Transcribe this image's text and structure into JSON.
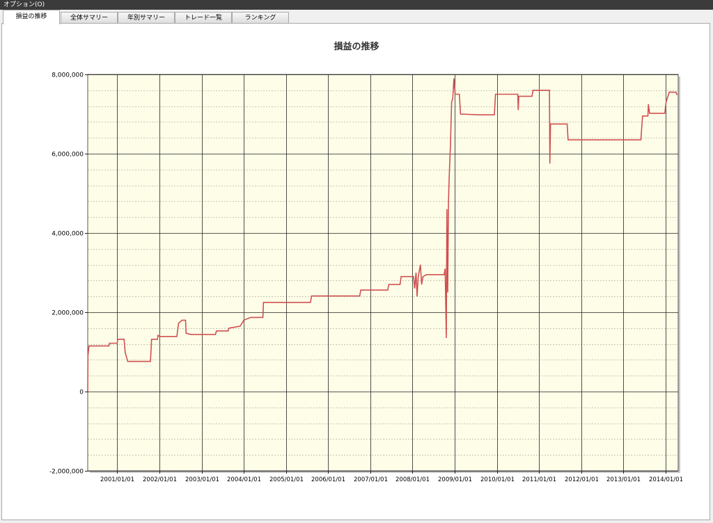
{
  "window": {
    "title": "オプション(O)"
  },
  "tabs": [
    {
      "label": "損益の推移",
      "active": true
    },
    {
      "label": "全体サマリー",
      "active": false
    },
    {
      "label": "年別サマリー",
      "active": false
    },
    {
      "label": "トレード一覧",
      "active": false
    },
    {
      "label": "ランキング",
      "active": false
    }
  ],
  "chart_data": {
    "type": "line",
    "title": "損益の推移",
    "xlabel": "",
    "ylabel": "",
    "ylim": [
      -2000000,
      8000000
    ],
    "y_ticks": [
      8000000,
      6000000,
      4000000,
      2000000,
      0,
      -2000000
    ],
    "y_tick_labels": [
      "8,000,000",
      "6,000,000",
      "4,000,000",
      "2,000,000",
      "0",
      "-2,000,000"
    ],
    "x_tick_labels": [
      "2001/01/01",
      "2002/01/01",
      "2003/01/01",
      "2004/01/01",
      "2005/01/01",
      "2006/01/01",
      "2007/01/01",
      "2008/01/01",
      "2009/01/01",
      "2010/01/01",
      "2011/01/01",
      "2012/01/01",
      "2013/01/01",
      "2014/01/01"
    ],
    "x_range": [
      "2000/04/20",
      "2014/04/20"
    ],
    "grid": true,
    "background_color": "#fefee8",
    "line_color": "#d05050",
    "series": [
      {
        "points": [
          [
            "2000/04/20",
            0
          ],
          [
            "2000/04/22",
            900000
          ],
          [
            "2000/05/01",
            1150000
          ],
          [
            "2000/10/20",
            1150000
          ],
          [
            "2000/10/25",
            1220000
          ],
          [
            "2000/12/31",
            1220000
          ],
          [
            "2001/01/05",
            1320000
          ],
          [
            "2001/03/01",
            1320000
          ],
          [
            "2001/03/10",
            1000000
          ],
          [
            "2001/04/01",
            760000
          ],
          [
            "2001/10/15",
            760000
          ],
          [
            "2001/10/25",
            1320000
          ],
          [
            "2001/12/15",
            1320000
          ],
          [
            "2001/12/20",
            1420000
          ],
          [
            "2002/01/01",
            1390000
          ],
          [
            "2002/06/01",
            1390000
          ],
          [
            "2002/06/15",
            1720000
          ],
          [
            "2002/07/15",
            1800000
          ],
          [
            "2002/08/15",
            1800000
          ],
          [
            "2002/08/20",
            1470000
          ],
          [
            "2002/10/01",
            1440000
          ],
          [
            "2003/05/01",
            1440000
          ],
          [
            "2003/05/10",
            1530000
          ],
          [
            "2003/08/20",
            1530000
          ],
          [
            "2003/08/25",
            1600000
          ],
          [
            "2003/12/01",
            1650000
          ],
          [
            "2004/01/01",
            1800000
          ],
          [
            "2004/03/01",
            1870000
          ],
          [
            "2004/06/15",
            1870000
          ],
          [
            "2004/06/20",
            2250000
          ],
          [
            "2005/08/01",
            2250000
          ],
          [
            "2005/08/10",
            2410000
          ],
          [
            "2006/10/01",
            2410000
          ],
          [
            "2006/10/10",
            2560000
          ],
          [
            "2007/06/01",
            2560000
          ],
          [
            "2007/06/10",
            2700000
          ],
          [
            "2007/09/15",
            2700000
          ],
          [
            "2007/09/25",
            2900000
          ],
          [
            "2008/01/10",
            2900000
          ],
          [
            "2008/01/20",
            2600000
          ],
          [
            "2008/02/01",
            3000000
          ],
          [
            "2008/02/10",
            2400000
          ],
          [
            "2008/02/20",
            2900000
          ],
          [
            "2008/03/10",
            3200000
          ],
          [
            "2008/03/20",
            2700000
          ],
          [
            "2008/04/01",
            2900000
          ],
          [
            "2008/05/01",
            2950000
          ],
          [
            "2008/10/01",
            2950000
          ],
          [
            "2008/10/10",
            3100000
          ],
          [
            "2008/10/20",
            1350000
          ],
          [
            "2008/10/25",
            4600000
          ],
          [
            "2008/11/01",
            2500000
          ],
          [
            "2008/11/08",
            4800000
          ],
          [
            "2008/11/15",
            5500000
          ],
          [
            "2008/11/25",
            6200000
          ],
          [
            "2008/12/05",
            7300000
          ],
          [
            "2008/12/15",
            7400000
          ],
          [
            "2008/12/25",
            7900000
          ],
          [
            "2009/01/05",
            7500000
          ],
          [
            "2009/02/10",
            7500000
          ],
          [
            "2009/02/20",
            7000000
          ],
          [
            "2009/08/01",
            6980000
          ],
          [
            "2009/12/10",
            6980000
          ],
          [
            "2009/12/20",
            7500000
          ],
          [
            "2010/07/01",
            7500000
          ],
          [
            "2010/07/05",
            7100000
          ],
          [
            "2010/07/10",
            7450000
          ],
          [
            "2010/11/01",
            7450000
          ],
          [
            "2010/11/10",
            7600000
          ],
          [
            "2011/04/01",
            7600000
          ],
          [
            "2011/04/05",
            5750000
          ],
          [
            "2011/04/10",
            6750000
          ],
          [
            "2011/09/01",
            6750000
          ],
          [
            "2011/09/10",
            6350000
          ],
          [
            "2013/06/01",
            6350000
          ],
          [
            "2013/06/15",
            6950000
          ],
          [
            "2013/08/01",
            6950000
          ],
          [
            "2013/08/05",
            7250000
          ],
          [
            "2013/08/15",
            7020000
          ],
          [
            "2013/12/25",
            7020000
          ],
          [
            "2014/01/05",
            7300000
          ],
          [
            "2014/02/01",
            7550000
          ],
          [
            "2014/04/01",
            7550000
          ],
          [
            "2014/04/10",
            7480000
          ]
        ]
      }
    ]
  }
}
